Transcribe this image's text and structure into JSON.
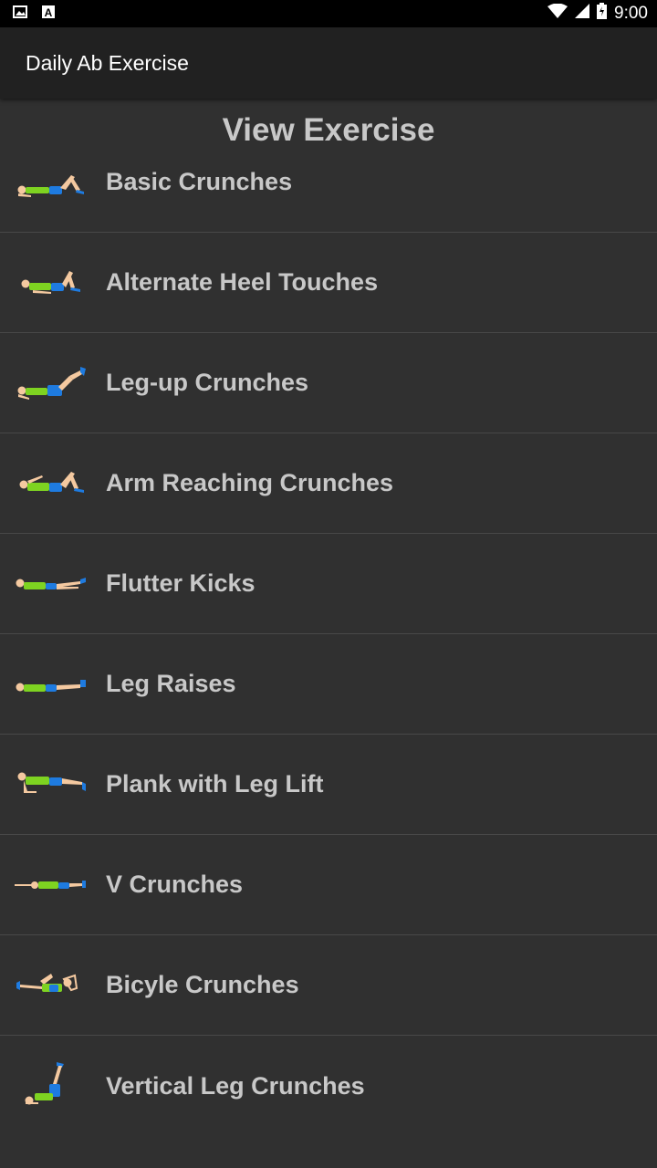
{
  "status_bar": {
    "time": "9:00",
    "icons": [
      "image-icon",
      "a-icon",
      "wifi-icon",
      "signal-icon",
      "battery-icon"
    ]
  },
  "app_bar": {
    "title": "Daily Ab Exercise"
  },
  "header": {
    "title": "View Exercise"
  },
  "exercises": [
    {
      "label": "Basic Crunches",
      "icon": "basic-crunches-icon"
    },
    {
      "label": "Alternate Heel Touches",
      "icon": "alternate-heel-touches-icon"
    },
    {
      "label": "Leg-up Crunches",
      "icon": "leg-up-crunches-icon"
    },
    {
      "label": "Arm Reaching Crunches",
      "icon": "arm-reaching-crunches-icon"
    },
    {
      "label": "Flutter Kicks",
      "icon": "flutter-kicks-icon"
    },
    {
      "label": "Leg Raises",
      "icon": "leg-raises-icon"
    },
    {
      "label": "Plank with Leg Lift",
      "icon": "plank-with-leg-lift-icon"
    },
    {
      "label": "V Crunches",
      "icon": "v-crunches-icon"
    },
    {
      "label": "Bicyle Crunches",
      "icon": "bicycle-crunches-icon"
    },
    {
      "label": "Vertical Leg Crunches",
      "icon": "vertical-leg-crunches-icon"
    }
  ],
  "colors": {
    "background": "#303030",
    "app_bar": "#212121",
    "text": "#c8c8c8",
    "shirt": "#7ed321",
    "shorts": "#1e7be0",
    "skin": "#f4c9a0"
  }
}
